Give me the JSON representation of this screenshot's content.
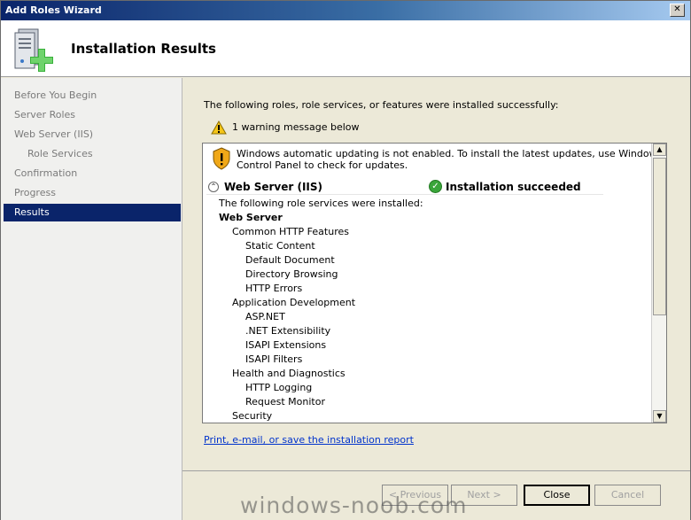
{
  "window": {
    "title": "Add Roles Wizard",
    "close_glyph": "✕"
  },
  "header": {
    "title": "Installation Results",
    "icon": "server-add-icon"
  },
  "nav": {
    "items": [
      {
        "label": "Before You Begin",
        "sub": false,
        "selected": false
      },
      {
        "label": "Server Roles",
        "sub": false,
        "selected": false
      },
      {
        "label": "Web Server (IIS)",
        "sub": false,
        "selected": false
      },
      {
        "label": "Role Services",
        "sub": true,
        "selected": false
      },
      {
        "label": "Confirmation",
        "sub": false,
        "selected": false
      },
      {
        "label": "Progress",
        "sub": false,
        "selected": false
      },
      {
        "label": "Results",
        "sub": false,
        "selected": true
      }
    ]
  },
  "main": {
    "intro": "The following roles, role services, or features were installed successfully:",
    "warning_count": "1 warning message below",
    "warning_line1": "Windows automatic updating is not enabled. To install the latest updates, use Windows Update in",
    "warning_line2": "Control Panel to check for updates.",
    "section_name": "Web Server (IIS)",
    "section_status": "Installation succeeded",
    "collapse_glyph": "⌃",
    "check_glyph": "✓",
    "installed_intro": "The following role services were installed:",
    "services": [
      {
        "text": "Web Server",
        "level": 0,
        "bold": true
      },
      {
        "text": "Common HTTP Features",
        "level": 1,
        "bold": false
      },
      {
        "text": "Static Content",
        "level": 2,
        "bold": false
      },
      {
        "text": "Default Document",
        "level": 2,
        "bold": false
      },
      {
        "text": "Directory Browsing",
        "level": 2,
        "bold": false
      },
      {
        "text": "HTTP Errors",
        "level": 2,
        "bold": false
      },
      {
        "text": "Application Development",
        "level": 1,
        "bold": false
      },
      {
        "text": "ASP.NET",
        "level": 2,
        "bold": false
      },
      {
        "text": ".NET Extensibility",
        "level": 2,
        "bold": false
      },
      {
        "text": "ISAPI Extensions",
        "level": 2,
        "bold": false
      },
      {
        "text": "ISAPI Filters",
        "level": 2,
        "bold": false
      },
      {
        "text": "Health and Diagnostics",
        "level": 1,
        "bold": false
      },
      {
        "text": "HTTP Logging",
        "level": 2,
        "bold": false
      },
      {
        "text": "Request Monitor",
        "level": 2,
        "bold": false
      },
      {
        "text": "Security",
        "level": 1,
        "bold": false
      }
    ],
    "report_link": "Print, e-mail, or save the installation report",
    "scroll_up_glyph": "▲",
    "scroll_down_glyph": "▼"
  },
  "footer": {
    "previous": "< Previous",
    "next": "Next >",
    "close": "Close",
    "cancel": "Cancel"
  },
  "watermark": "windows-noob.com"
}
